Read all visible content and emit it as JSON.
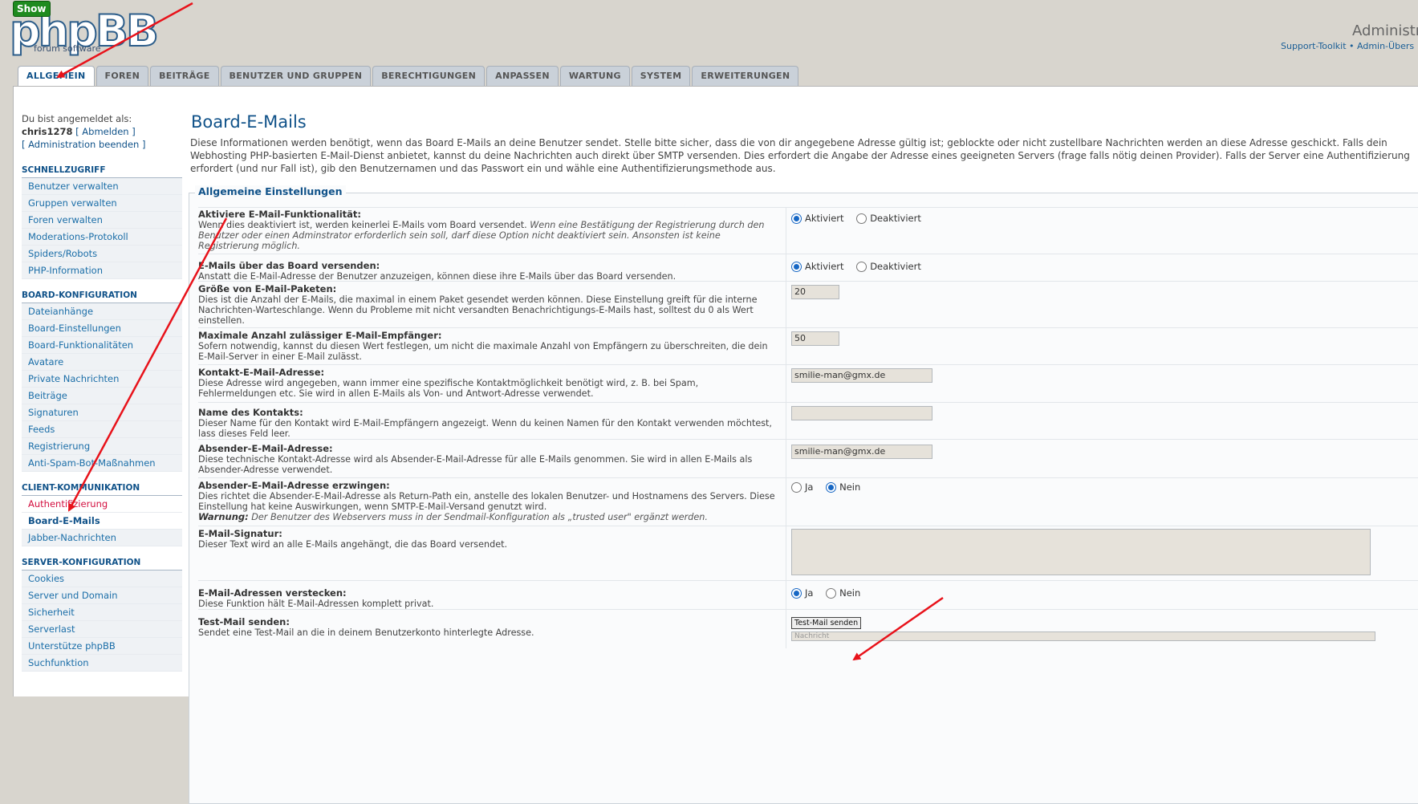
{
  "show_button": "Show",
  "logo": {
    "wordmark": "phpBB",
    "sub": "forum  software"
  },
  "header": {
    "title": "Administr",
    "links": "Support-Toolkit • Admin-Übers"
  },
  "tabs": [
    "ALLGEMEIN",
    "FOREN",
    "BEITRÄGE",
    "BENUTZER UND GRUPPEN",
    "BERECHTIGUNGEN",
    "ANPASSEN",
    "WARTUNG",
    "SYSTEM",
    "ERWEITERUNGEN"
  ],
  "user": {
    "logged_as": "Du bist angemeldet als:",
    "name": "chris1278",
    "logout": "[ Abmelden ]",
    "end_admin": "[ Administration beenden ]"
  },
  "sidebar": {
    "schnell": {
      "title": "SCHNELLZUGRIFF",
      "items": [
        "Benutzer verwalten",
        "Gruppen verwalten",
        "Foren verwalten",
        "Moderations-Protokoll",
        "Spiders/Robots",
        "PHP-Information"
      ]
    },
    "board": {
      "title": "BOARD-KONFIGURATION",
      "items": [
        "Dateianhänge",
        "Board-Einstellungen",
        "Board-Funktionalitäten",
        "Avatare",
        "Private Nachrichten",
        "Beiträge",
        "Signaturen",
        "Feeds",
        "Registrierung",
        "Anti-Spam-Bot-Maßnahmen"
      ]
    },
    "client": {
      "title": "CLIENT-KOMMUNIKATION",
      "items": [
        "Authentifizierung",
        "Board-E-Mails",
        "Jabber-Nachrichten"
      ]
    },
    "server": {
      "title": "SERVER-KONFIGURATION",
      "items": [
        "Cookies",
        "Server und Domain",
        "Sicherheit",
        "Serverlast",
        "Unterstütze phpBB",
        "Suchfunktion"
      ]
    }
  },
  "main": {
    "title": "Board-E-Mails",
    "intro": "Diese Informationen werden benötigt, wenn das Board E-Mails an deine Benutzer sendet. Stelle bitte sicher, dass die von dir angegebene Adresse gültig ist; geblockte oder nicht zustellbare Nachrichten werden an diese Adresse geschickt. Falls dein Webhosting PHP-basierten E-Mail-Dienst anbietet, kannst du deine Nachrichten auch direkt über SMTP versenden. Dies erfordert die Angabe der Adresse eines geeigneten Servers (frage falls nötig deinen Provider). Falls der Server eine Authentifizierung erfordert (und nur Fall ist), gib den Benutzernamen und das Passwort ein und wähle eine Authentifizierungsmethode aus.",
    "legend": "Allgemeine Einstellungen"
  },
  "settings": {
    "email_func": {
      "label": "Aktiviere E-Mail-Funktionalität:",
      "desc": "Wenn dies deaktiviert ist, werden keinerlei E-Mails vom Board versendet.",
      "desc_italic": "Wenn eine Bestätigung der Registrierung durch den Benutzer oder einen Adminstrator erforderlich sein soll, darf diese Option nicht deaktiviert sein. Ansonsten ist keine Registrierung möglich.",
      "opt1": "Aktiviert",
      "opt2": "Deaktiviert"
    },
    "board_mail": {
      "label": "E-Mails über das Board versenden:",
      "desc": "Anstatt die E-Mail-Adresse der Benutzer anzuzeigen, können diese ihre E-Mails über das Board versenden.",
      "opt1": "Aktiviert",
      "opt2": "Deaktiviert"
    },
    "package": {
      "label": "Größe von E-Mail-Paketen:",
      "desc": "Dies ist die Anzahl der E-Mails, die maximal in einem Paket gesendet werden können. Diese Einstellung greift für die interne Nachrichten-Warteschlange. Wenn du Probleme mit nicht versandten Benachrichtigungs-E-Mails hast, solltest du 0 als Wert einstellen.",
      "value": "20"
    },
    "max_rcpt": {
      "label": "Maximale Anzahl zulässiger E-Mail-Empfänger:",
      "desc": "Sofern notwendig, kannst du diesen Wert festlegen, um nicht die maximale Anzahl von Empfängern zu überschreiten, die dein E-Mail-Server in einer E-Mail zulässt.",
      "value": "50"
    },
    "contact": {
      "label": "Kontakt-E-Mail-Adresse:",
      "desc": "Diese Adresse wird angegeben, wann immer eine spezifische Kontaktmöglichkeit benötigt wird, z. B. bei Spam, Fehlermeldungen etc. Sie wird in allen E-Mails als Von- und Antwort-Adresse verwendet.",
      "value": "smilie-man@gmx.de"
    },
    "contact_name": {
      "label": "Name des Kontakts:",
      "desc": "Dieser Name für den Kontakt wird E-Mail-Empfängern angezeigt. Wenn du keinen Namen für den Kontakt verwenden möchtest, lass dieses Feld leer.",
      "value": ""
    },
    "sender": {
      "label": "Absender-E-Mail-Adresse:",
      "desc": "Diese technische Kontakt-Adresse wird als Absender-E-Mail-Adresse für alle E-Mails genommen. Sie wird in allen E-Mails als Absender-Adresse verwendet.",
      "value": "smilie-man@gmx.de"
    },
    "force_sender": {
      "label": "Absender-E-Mail-Adresse erzwingen:",
      "desc": "Dies richtet die Absender-E-Mail-Adresse als Return-Path ein, anstelle des lokalen Benutzer- und Hostnamens des Servers. Diese Einstellung hat keine Auswirkungen, wenn SMTP-E-Mail-Versand genutzt wird.",
      "warn_label": "Warnung:",
      "warn": "Der Benutzer des Webservers muss in der Sendmail-Konfiguration als „trusted user\" ergänzt werden.",
      "opt1": "Ja",
      "opt2": "Nein"
    },
    "signature": {
      "label": "E-Mail-Signatur:",
      "desc": "Dieser Text wird an alle E-Mails angehängt, die das Board versendet."
    },
    "hide": {
      "label": "E-Mail-Adressen verstecken:",
      "desc": "Diese Funktion hält E-Mail-Adressen komplett privat.",
      "opt1": "Ja",
      "opt2": "Nein"
    },
    "test": {
      "label": "Test-Mail senden:",
      "desc": "Sendet eine Test-Mail an die in deinem Benutzerkonto hinterlegte Adresse.",
      "button": "Test-Mail senden",
      "placeholder": "Nachricht"
    }
  },
  "annotation_color": "#e8121a"
}
